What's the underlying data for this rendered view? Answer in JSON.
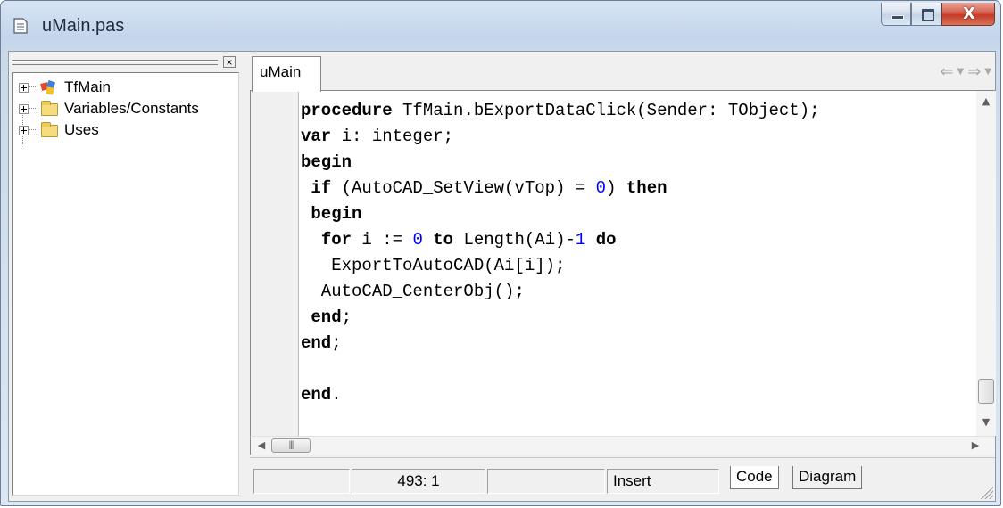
{
  "window": {
    "title": "uMain.pas",
    "close_glyph": "X"
  },
  "left_panel": {
    "close_glyph": "×",
    "tree_items": [
      {
        "label": "TfMain",
        "icon": "form-class-icon"
      },
      {
        "label": "Variables/Constants",
        "icon": "folder-icon"
      },
      {
        "label": "Uses",
        "icon": "folder-icon"
      }
    ]
  },
  "editor": {
    "tab_label": "uMain",
    "code_lines": [
      "procedure TfMain.bExportDataClick(Sender: TObject);",
      "var i: integer;",
      "begin",
      " if (AutoCAD_SetView(vTop) = 0) then",
      " begin",
      "  for i := 0 to Length(Ai)-1 do",
      "   ExportToAutoCAD(Ai[i]);",
      "  AutoCAD_CenterObj();",
      " end;",
      "end;",
      "",
      "end."
    ]
  },
  "status_bar": {
    "position": "493:  1",
    "mode": "Insert",
    "tabs": [
      "Code",
      "Diagram"
    ]
  },
  "colors": {
    "number_literal": "#0000ff",
    "close_button": "#c43a26"
  }
}
